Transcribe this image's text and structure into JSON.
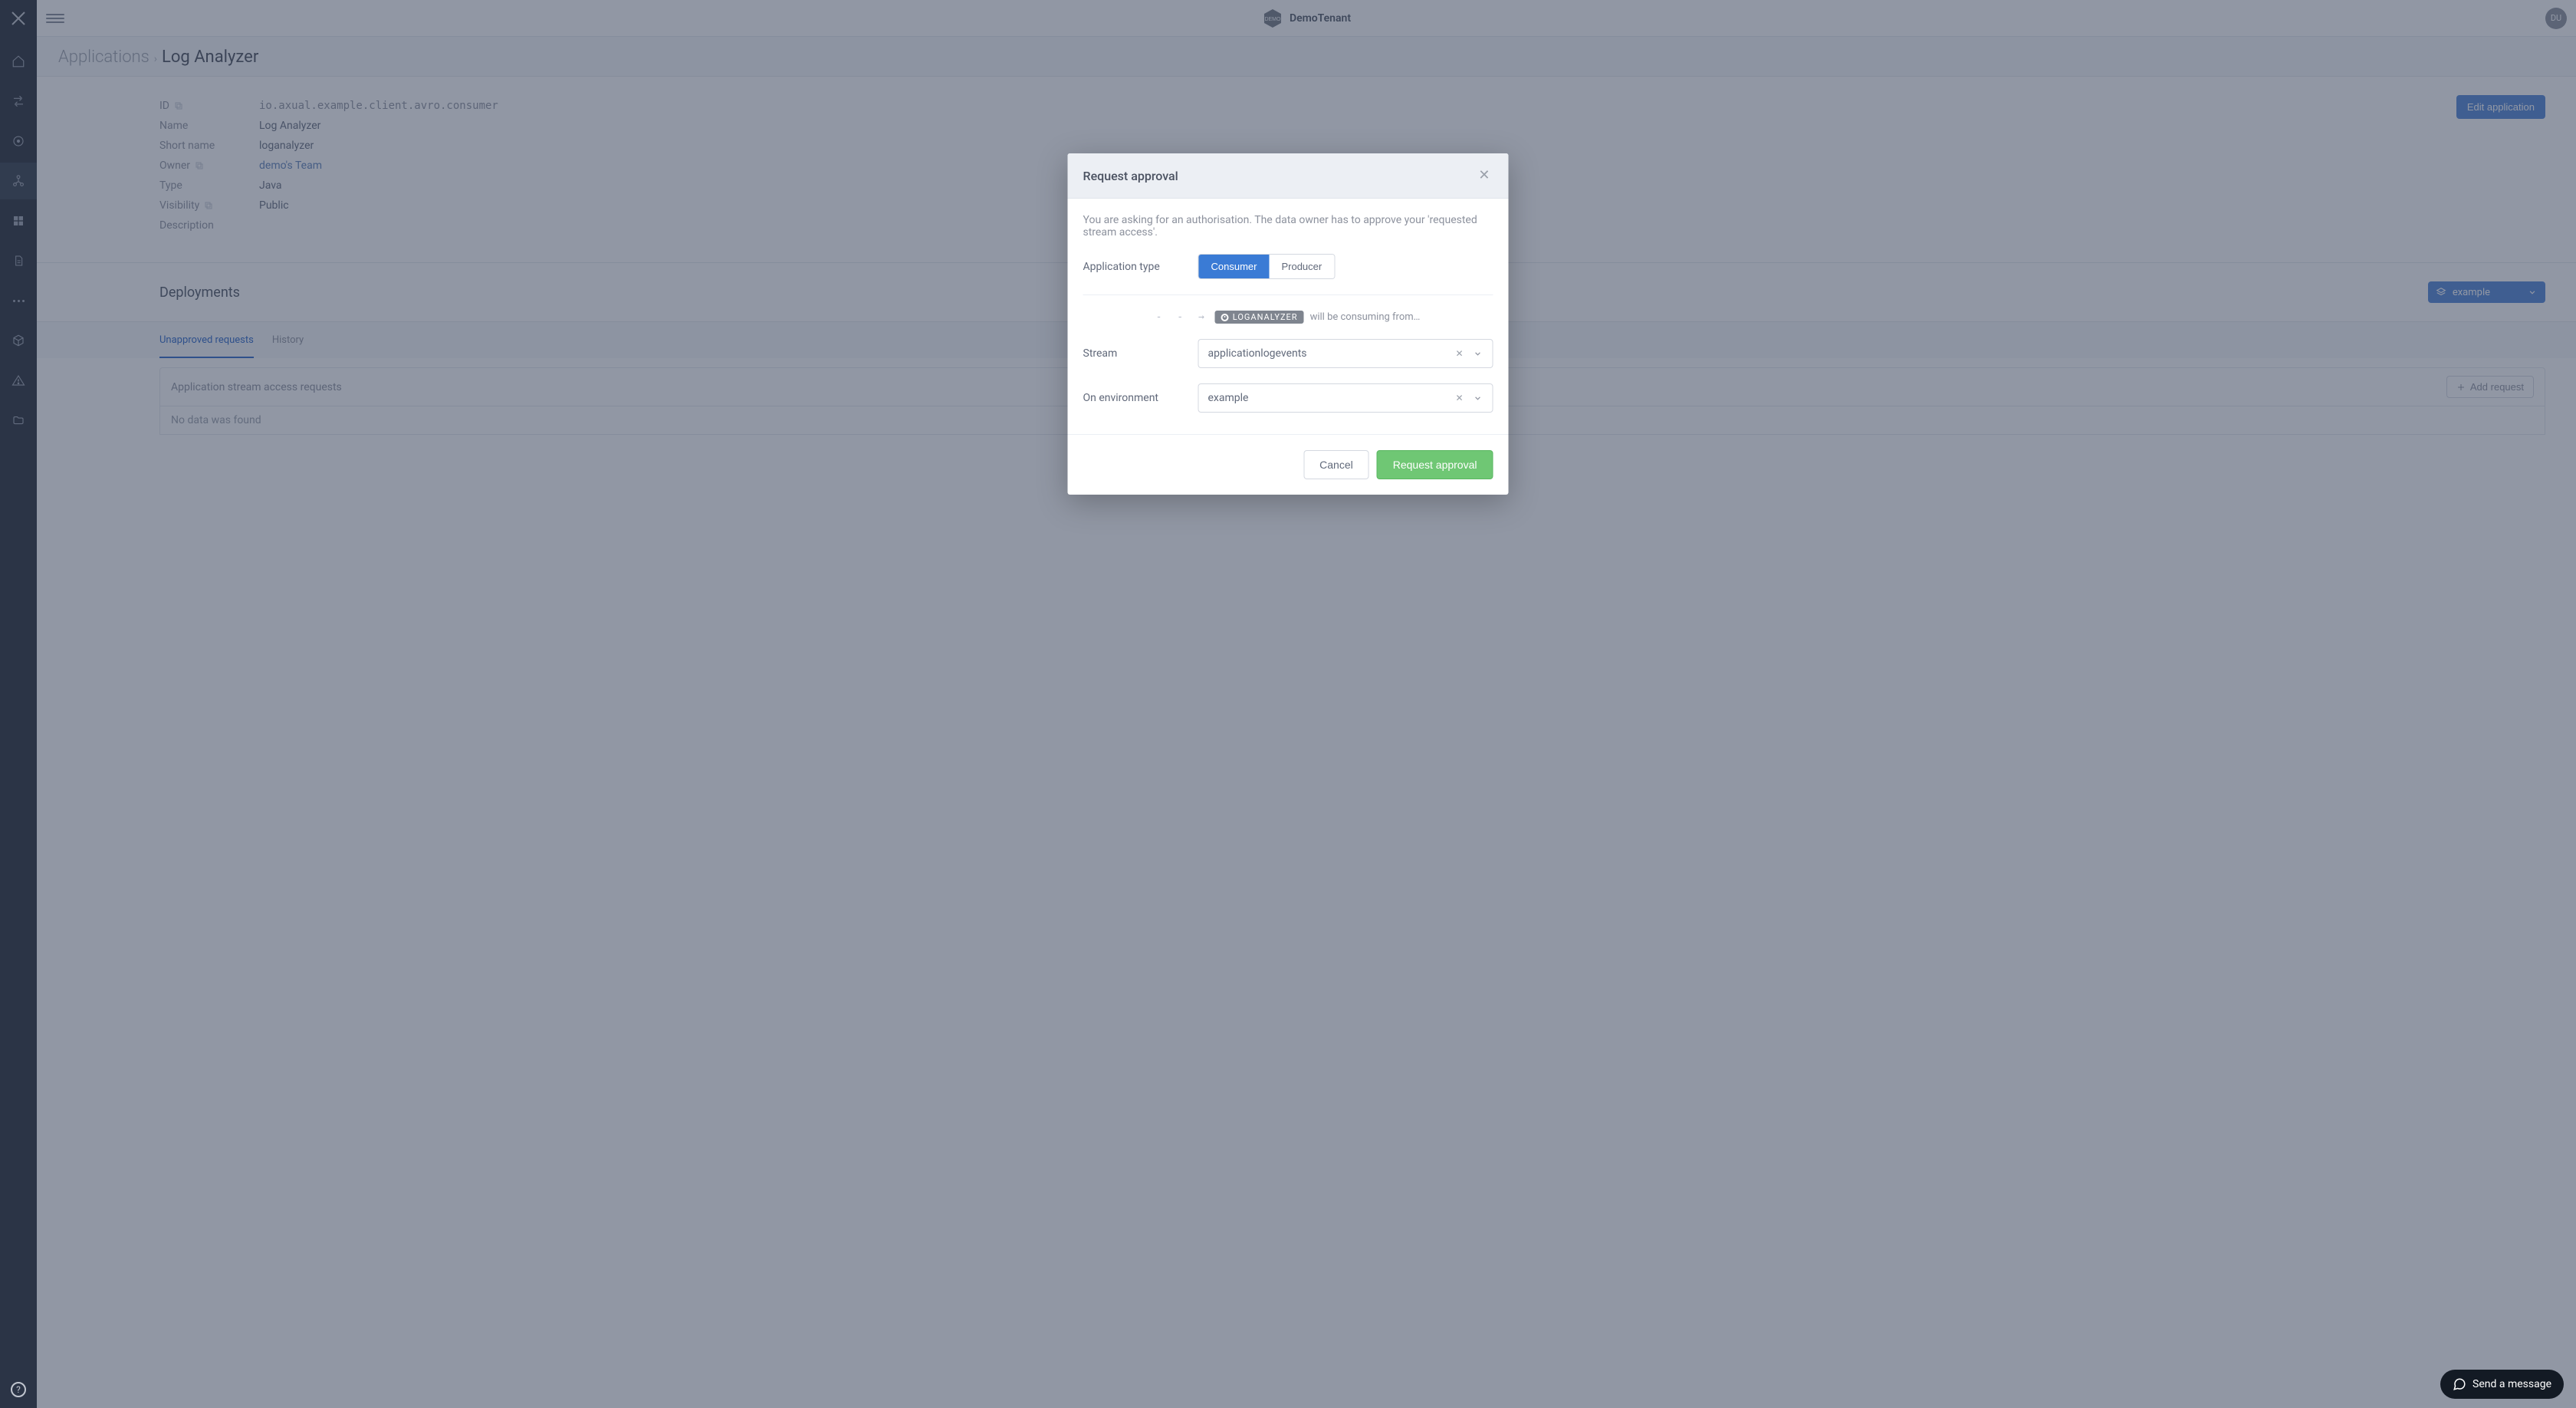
{
  "topbar": {
    "tenant": "DemoTenant",
    "tenant_badge": "DEMO",
    "avatar": "DU"
  },
  "breadcrumb": {
    "link": "Applications",
    "current": "Log Analyzer"
  },
  "details": {
    "edit_button": "Edit application",
    "rows": {
      "id": {
        "key": "ID",
        "value": "io.axual.example.client.avro.consumer"
      },
      "name": {
        "key": "Name",
        "value": "Log Analyzer"
      },
      "short_name": {
        "key": "Short name",
        "value": "loganalyzer"
      },
      "owner": {
        "key": "Owner",
        "value": "demo's Team"
      },
      "type": {
        "key": "Type",
        "value": "Java"
      },
      "visibility": {
        "key": "Visibility",
        "value": "Public"
      },
      "description": {
        "key": "Description",
        "value": ""
      }
    }
  },
  "deployments": {
    "title": "Deployments",
    "env": "example",
    "tabs": {
      "unapproved": "Unapproved requests",
      "history": "History"
    },
    "table": {
      "header": "Application stream access requests",
      "add_button": "Add request",
      "empty": "No data was found"
    }
  },
  "modal": {
    "title": "Request approval",
    "intro": "You are asking for an authorisation. The data owner has to approve your 'requested stream access'.",
    "app_type": {
      "label": "Application type",
      "consumer": "Consumer",
      "producer": "Producer"
    },
    "flow": {
      "app_tag": "LOGANALYZER",
      "text": "will be consuming from…"
    },
    "stream": {
      "label": "Stream",
      "value": "applicationlogevents"
    },
    "environment": {
      "label": "On environment",
      "value": "example"
    },
    "buttons": {
      "cancel": "Cancel",
      "submit": "Request approval"
    }
  },
  "chat": {
    "label": "Send a message"
  }
}
